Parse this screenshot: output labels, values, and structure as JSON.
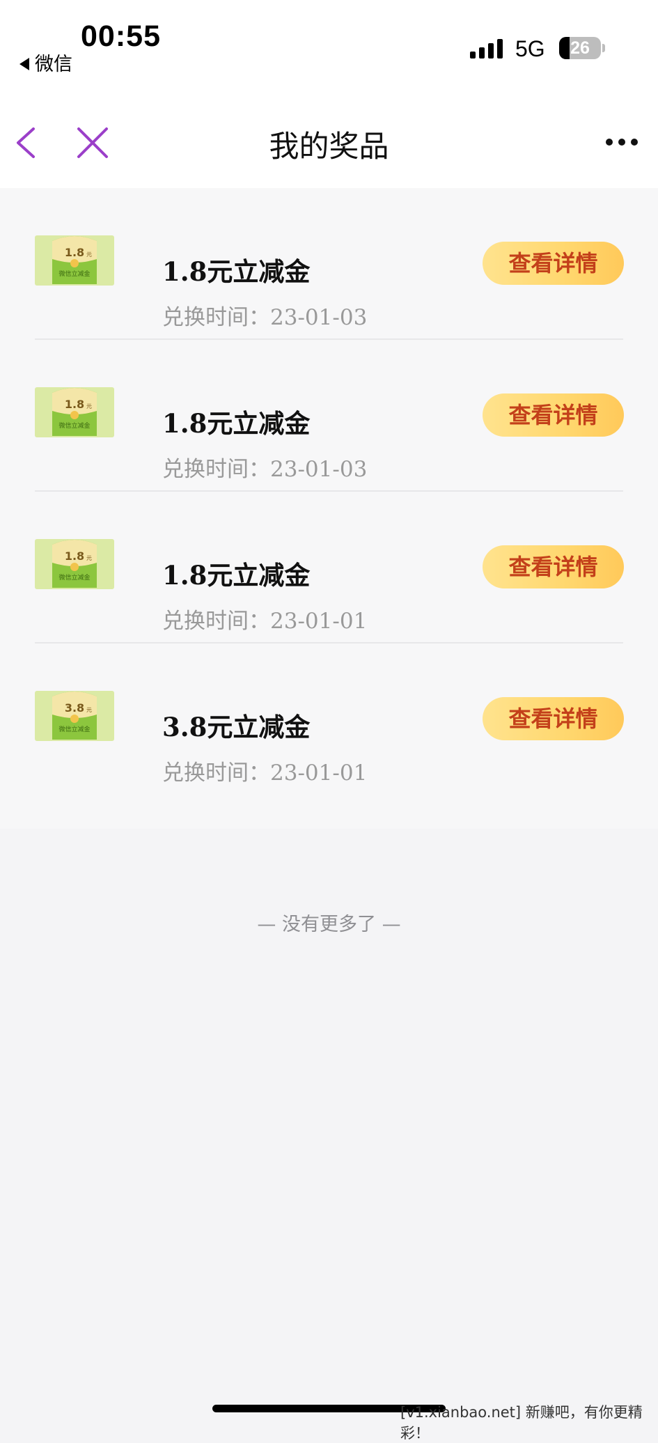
{
  "status_bar": {
    "time": "00:55",
    "back_app": "微信",
    "network": "5G",
    "battery": "26"
  },
  "nav": {
    "title": "我的奖品"
  },
  "prizes": [
    {
      "amount": "1.8",
      "amount_unit": "元",
      "image_caption": "微信立减金",
      "name": "1.8元立减金",
      "time_label": "兑换时间：",
      "time": "23-01-03",
      "button": "查看详情"
    },
    {
      "amount": "1.8",
      "amount_unit": "元",
      "image_caption": "微信立减金",
      "name": "1.8元立减金",
      "time_label": "兑换时间：",
      "time": "23-01-03",
      "button": "查看详情"
    },
    {
      "amount": "1.8",
      "amount_unit": "元",
      "image_caption": "微信立减金",
      "name": "1.8元立减金",
      "time_label": "兑换时间：",
      "time": "23-01-01",
      "button": "查看详情"
    },
    {
      "amount": "3.8",
      "amount_unit": "元",
      "image_caption": "微信立减金",
      "name": "3.8元立减金",
      "time_label": "兑换时间：",
      "time": "23-01-01",
      "button": "查看详情"
    }
  ],
  "footer": {
    "no_more": "— 没有更多了 —",
    "watermark": "[v1.xianbao.net] 新赚吧，有你更精彩！"
  },
  "colors": {
    "nav_icon": "#9b3fc9",
    "button_text": "#c3401a",
    "button_bg": "#ffd76e",
    "envelope_green": "#8cc63e"
  },
  "icons": {
    "back": "chevron-left-icon",
    "close": "close-icon",
    "more": "more-dots-icon"
  }
}
